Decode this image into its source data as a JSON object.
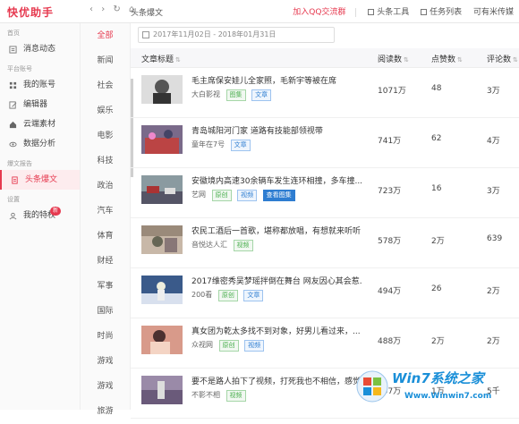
{
  "app": {
    "logo": "快优助手"
  },
  "topbar": {
    "nav_buttons": [
      "‹",
      "›",
      "↻",
      "⌂"
    ],
    "page_title": "头条爆文",
    "qq_group": "加入QQ交流群",
    "toutiao_tool": "头条工具",
    "task_list": "任务列表",
    "account": "可有米传媒"
  },
  "sidebar": {
    "sections": [
      {
        "label": "首页",
        "items": [
          {
            "label": "消息动态",
            "icon": "message-icon"
          }
        ]
      },
      {
        "label": "平台账号",
        "items": [
          {
            "label": "我的账号",
            "icon": "grid-icon"
          },
          {
            "label": "编辑器",
            "icon": "edit-icon"
          },
          {
            "label": "云端素材",
            "icon": "cloud-icon"
          },
          {
            "label": "数据分析",
            "icon": "eye-icon"
          }
        ]
      },
      {
        "label": "爆文报告",
        "items": [
          {
            "label": "头条爆文",
            "icon": "document-icon",
            "active": true
          }
        ]
      },
      {
        "label": "设置",
        "items": [
          {
            "label": "我的特权",
            "icon": "user-icon",
            "badge": "新"
          }
        ]
      }
    ]
  },
  "categories": [
    "全部",
    "新闻",
    "社会",
    "娱乐",
    "电影",
    "科技",
    "政治",
    "汽车",
    "体育",
    "财经",
    "军事",
    "国际",
    "时尚",
    "游戏",
    "游戏",
    "旅游"
  ],
  "filter": {
    "date_range": "2017年11月02日  -  2018年01月31日"
  },
  "table": {
    "headers": {
      "title": "文章标题",
      "reads": "阅读数",
      "likes": "点赞数",
      "comments": "评论数"
    },
    "rows": [
      {
        "title": "毛主席保安娃儿全家照，毛新宇等被在席",
        "source": "大白影视",
        "tags": [
          {
            "text": "图集",
            "style": "green"
          },
          {
            "text": "文章",
            "style": "blue"
          }
        ],
        "reads": "1071万",
        "likes": "48",
        "comments": "3万"
      },
      {
        "title": "青岛城阳河门家 道路有技能部领视带",
        "source": "童年在7号",
        "tags": [
          {
            "text": "文章",
            "style": "blue"
          }
        ],
        "reads": "741万",
        "likes": "62",
        "comments": "4万"
      },
      {
        "title": "安徽境内高速30余辆车发生连环相撞，多车撞...",
        "source": "艺网",
        "tags": [
          {
            "text": "原创",
            "style": "green"
          },
          {
            "text": "视频",
            "style": "blue"
          },
          {
            "text": "查看图集",
            "style": "solidblue"
          }
        ],
        "reads": "723万",
        "likes": "16",
        "comments": "3万"
      },
      {
        "title": "农民工酒后一首歌，堪称都放唱，有想就来听听",
        "source": "音悦达人汇",
        "tags": [
          {
            "text": "视频",
            "style": "green"
          }
        ],
        "reads": "578万",
        "likes": "2万",
        "comments": "639"
      },
      {
        "title": "2017维密秀吴梦瑶拌倒在舞台 网友因心其会惹...",
        "source": "200看",
        "tags": [
          {
            "text": "原创",
            "style": "green"
          },
          {
            "text": "文章",
            "style": "blue"
          }
        ],
        "reads": "494万",
        "likes": "26",
        "comments": "2万"
      },
      {
        "title": "真女团为乾太多找不到对象，好男儿看过来，...",
        "source": "众视网",
        "tags": [
          {
            "text": "原创",
            "style": "green"
          },
          {
            "text": "视频",
            "style": "blue"
          }
        ],
        "reads": "488万",
        "likes": "2万",
        "comments": "2万"
      },
      {
        "title": "要不是路人拍下了视频，打死我也不相信，感觉...",
        "source": "不影不相",
        "tags": [
          {
            "text": "视频",
            "style": "green"
          }
        ],
        "reads": "457万",
        "likes": "1万",
        "comments": "5千"
      }
    ]
  },
  "watermark": {
    "brand": "Win7系统之家",
    "url": "Www.Winwin7.com"
  },
  "colors": {
    "accent": "#e6394f",
    "tag_green": "#4caf50",
    "tag_blue": "#2e7dd1",
    "watermark": "#1a8fd8"
  }
}
